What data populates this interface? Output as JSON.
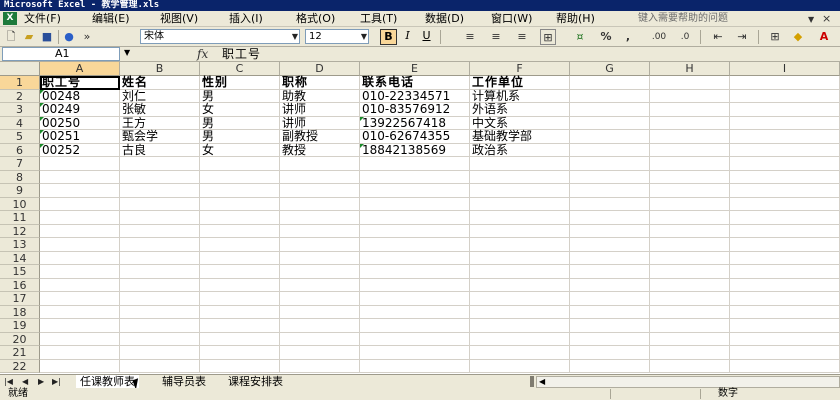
{
  "window": {
    "title": "Microsoft Excel - 教学管理.xls",
    "app_icon": "excel-icon"
  },
  "menu": {
    "items": [
      "文件(F)",
      "编辑(E)",
      "视图(V)",
      "插入(I)",
      "格式(O)",
      "工具(T)",
      "数据(D)",
      "窗口(W)",
      "帮助(H)"
    ],
    "help_placeholder": "键入需要帮助的问题",
    "close_glyph": "×"
  },
  "toolbar": {
    "font_name": "宋体",
    "font_size": "12",
    "bold": "B",
    "italic": "I",
    "underline": "U",
    "percent": "%",
    "comma": ",",
    "accent": "#f9d799"
  },
  "formula": {
    "name_box": "A1",
    "fx": "fx",
    "content": "职工号"
  },
  "grid": {
    "columns": [
      "A",
      "B",
      "C",
      "D",
      "E",
      "F",
      "G",
      "H",
      "I"
    ],
    "rows": [
      "1",
      "2",
      "3",
      "4",
      "5",
      "6",
      "7",
      "8",
      "9",
      "10",
      "11",
      "12",
      "13",
      "14",
      "15",
      "16",
      "17",
      "18",
      "19",
      "20",
      "21",
      "22"
    ],
    "headers": [
      "职工号",
      "姓名",
      "性别",
      "职称",
      "联系电话",
      "工作单位"
    ],
    "data": [
      [
        "00248",
        "刘仁",
        "男",
        "助教",
        "010-22334571",
        "计算机系"
      ],
      [
        "00249",
        "张敏",
        "女",
        "讲师",
        "010-83576912",
        "外语系"
      ],
      [
        "00250",
        "王方",
        "男",
        "讲师",
        "13922567418",
        "中文系"
      ],
      [
        "00251",
        "甄会学",
        "男",
        "副教授",
        "010-62674355",
        "基础教学部"
      ],
      [
        "00252",
        "古良",
        "女",
        "教授",
        "18842138569",
        "政治系"
      ]
    ]
  },
  "sheets": {
    "tabs": [
      "任课教师表",
      "辅导员表",
      "课程安排表"
    ],
    "active": "任课教师表"
  },
  "status": {
    "left": "就绪",
    "right": "数字"
  }
}
